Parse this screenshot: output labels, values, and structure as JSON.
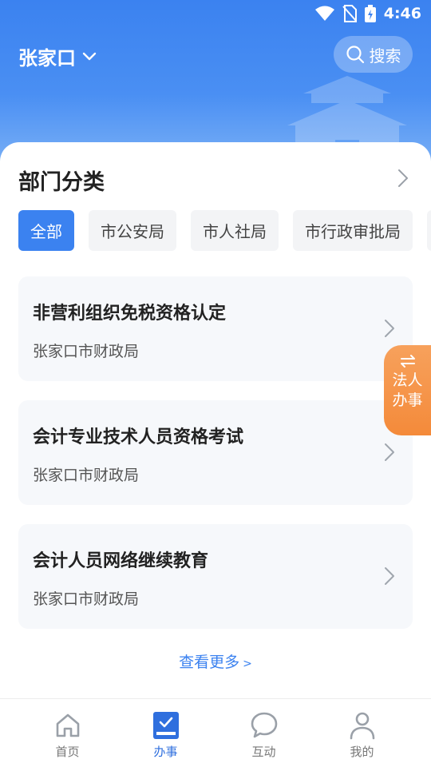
{
  "status_bar": {
    "time": "4:46"
  },
  "header": {
    "city": "张家口",
    "search_label": "搜索"
  },
  "categories": {
    "title": "部门分类",
    "chips": [
      {
        "label": "全部",
        "active": true
      },
      {
        "label": "市公安局",
        "active": false
      },
      {
        "label": "市人社局",
        "active": false
      },
      {
        "label": "市行政审批局",
        "active": false
      }
    ]
  },
  "items": [
    {
      "title": "非营利组织免税资格认定",
      "dept": "张家口市财政局"
    },
    {
      "title": "会计专业技术人员资格考试",
      "dept": "张家口市财政局"
    },
    {
      "title": "会计人员网络继续教育",
      "dept": "张家口市财政局"
    }
  ],
  "more_label": "查看更多",
  "more_chevron": ">",
  "float_button": {
    "line1": "法人",
    "line2": "办事",
    "icon": "swap-icon"
  },
  "tabs": [
    {
      "label": "首页",
      "icon": "home-icon",
      "active": false
    },
    {
      "label": "办事",
      "icon": "task-icon",
      "active": true
    },
    {
      "label": "互动",
      "icon": "chat-icon",
      "active": false
    },
    {
      "label": "我的",
      "icon": "user-icon",
      "active": false
    }
  ],
  "colors": {
    "primary": "#3b82f0",
    "accent": "#f48a3a",
    "tab_active": "#2f6fde"
  }
}
